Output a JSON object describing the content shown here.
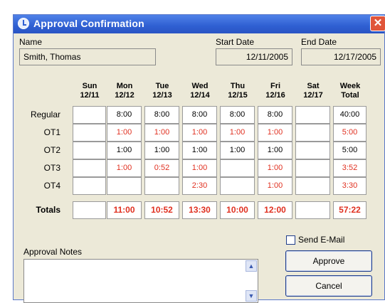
{
  "window": {
    "title": "Approval Confirmation",
    "close_glyph": "✕"
  },
  "fields": {
    "name_label": "Name",
    "name_value": "Smith, Thomas",
    "start_label": "Start Date",
    "start_value": "12/11/2005",
    "end_label": "End Date",
    "end_value": "12/17/2005"
  },
  "columns": [
    {
      "day": "Sun",
      "date": "12/11"
    },
    {
      "day": "Mon",
      "date": "12/12"
    },
    {
      "day": "Tue",
      "date": "12/13"
    },
    {
      "day": "Wed",
      "date": "12/14"
    },
    {
      "day": "Thu",
      "date": "12/15"
    },
    {
      "day": "Fri",
      "date": "12/16"
    },
    {
      "day": "Sat",
      "date": "12/17"
    },
    {
      "day": "Week",
      "date": "Total"
    }
  ],
  "rows": [
    {
      "label": "Regular",
      "cells": [
        "",
        "8:00",
        "8:00",
        "8:00",
        "8:00",
        "8:00",
        "",
        "40:00"
      ],
      "red": false
    },
    {
      "label": "OT1",
      "cells": [
        "",
        "1:00",
        "1:00",
        "1:00",
        "1:00",
        "1:00",
        "",
        "5:00"
      ],
      "red": true
    },
    {
      "label": "OT2",
      "cells": [
        "",
        "1:00",
        "1:00",
        "1:00",
        "1:00",
        "1:00",
        "",
        "5:00"
      ],
      "red": false
    },
    {
      "label": "OT3",
      "cells": [
        "",
        "1:00",
        "0:52",
        "1:00",
        "",
        "1:00",
        "",
        "3:52"
      ],
      "red": true
    },
    {
      "label": "OT4",
      "cells": [
        "",
        "",
        "",
        "2:30",
        "",
        "1:00",
        "",
        "3:30"
      ],
      "red": true
    },
    {
      "label": "Totals",
      "cells": [
        "",
        "11:00",
        "10:52",
        "13:30",
        "10:00",
        "12:00",
        "",
        "57:22"
      ],
      "red": true
    }
  ],
  "notes": {
    "label": "Approval Notes",
    "value": "",
    "scroll_up": "▲",
    "scroll_down": "▼"
  },
  "send_email_label": "Send E-Mail",
  "send_email_checked": false,
  "buttons": {
    "approve": "Approve",
    "cancel": "Cancel"
  },
  "colors": {
    "overtime_text": "#e03020",
    "titlebar": "#2f5fd2",
    "close": "#e0553a"
  }
}
